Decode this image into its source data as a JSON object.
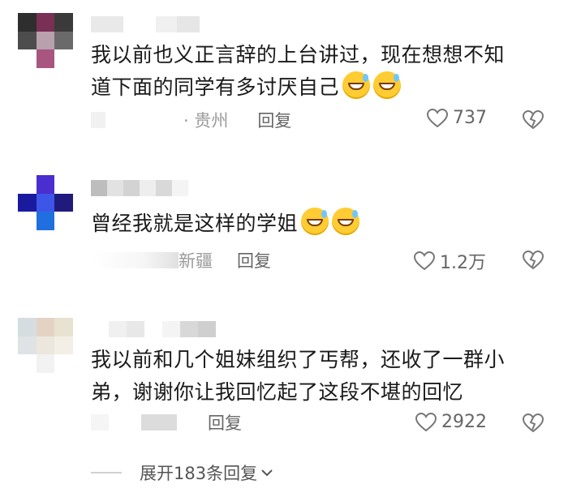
{
  "comments": [
    {
      "location": "贵州",
      "text_lines": [
        "我以前也义正言辞的上台讲过，现在想想不知",
        "道下面的同学有多讨厌自己"
      ],
      "reply_label": "回复",
      "like_count": "737",
      "emoji_icon": "grinning-sweat-emoji",
      "emoji_count": 2
    },
    {
      "location": "新疆",
      "text_lines": [
        "曾经我就是这样的学姐"
      ],
      "reply_label": "回复",
      "like_count": "1.2万",
      "emoji_icon": "grinning-sweat-emoji",
      "emoji_count": 2
    },
    {
      "location": "",
      "text_lines": [
        "我以前和几个姐妹组织了丐帮，还收了一群小",
        "弟，谢谢你让我回忆起了这段不堪的回忆"
      ],
      "reply_label": "回复",
      "like_count": "2922"
    }
  ],
  "expand_label": "展开183条回复",
  "icons": {
    "like": "heart-outline-icon",
    "dislike": "broken-heart-icon",
    "expand": "chevron-down-icon"
  },
  "colors": {
    "text": "#1a1a1a",
    "meta": "#8a8a8a",
    "emoji": "#ffcc33"
  }
}
